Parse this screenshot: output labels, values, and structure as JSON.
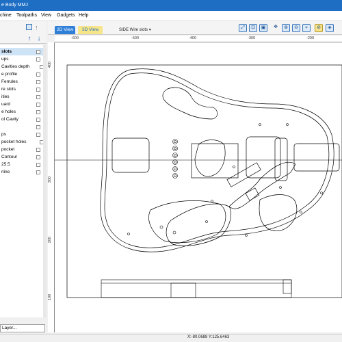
{
  "window": {
    "title": "e Body MMJ"
  },
  "menu": {
    "machine": "chine",
    "toolpaths": "Toolpaths",
    "view": "View",
    "gadgets": "Gadgets",
    "help": "Help"
  },
  "layers": {
    "items": [
      {
        "label": "slots",
        "selected": true
      },
      {
        "label": "ups",
        "selected": false
      },
      {
        "label": "Cavities depth",
        "selected": false
      },
      {
        "label": "e profile",
        "selected": false
      },
      {
        "label": "Ferrules",
        "selected": false
      },
      {
        "label": "re slots",
        "selected": false
      },
      {
        "label": "ities",
        "selected": false
      },
      {
        "label": "uard",
        "selected": false
      },
      {
        "label": "e holes",
        "selected": false
      },
      {
        "label": "ol Cavity",
        "selected": false
      },
      {
        "label": "",
        "selected": false
      },
      {
        "label": "ps",
        "selected": false
      },
      {
        "label": "pocket holes",
        "selected": false
      },
      {
        "label": "pocket",
        "selected": false
      },
      {
        "label": "Contour",
        "selected": false
      },
      {
        "label": "25.5",
        "selected": false
      },
      {
        "label": "rline",
        "selected": false
      }
    ],
    "add_layer": "Layer..."
  },
  "view": {
    "tab_2d": "2D View",
    "tab_3d": "3D View",
    "sheet": "SIDE Wire slots",
    "sheet_caret": "▾"
  },
  "rulers": {
    "top": [
      "-600",
      "-500",
      "-400",
      "-300",
      "-200"
    ],
    "left": [
      "400",
      "300",
      "200",
      "100"
    ]
  },
  "status": {
    "coords": "X:-80.0688 Y:125.6463"
  },
  "colors": {
    "titlebar": "#1e6fc4",
    "tab_2d": "#2f7fd9",
    "tab_3d": "#f7e58a",
    "selection": "#cfe3f7"
  }
}
